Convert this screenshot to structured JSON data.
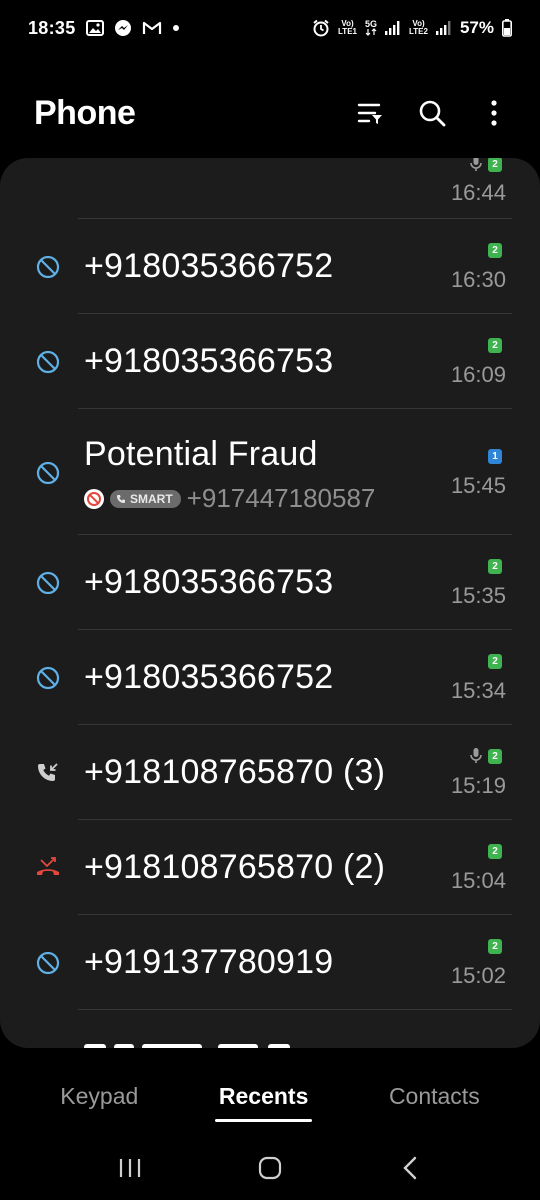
{
  "status_bar": {
    "time": "18:35",
    "battery_percent": "57%",
    "sim1_label_top": "Vo)",
    "sim1_label_bottom": "LTE1",
    "net_label": "5G",
    "sim2_label_top": "Vo)",
    "sim2_label_bottom": "LTE2",
    "notification_icons": [
      "gallery-icon",
      "messenger-icon",
      "gmail-icon",
      "dot-icon"
    ],
    "right_icons": [
      "alarm-icon",
      "signal-icon",
      "battery-icon"
    ]
  },
  "header": {
    "title": "Phone",
    "actions": [
      "filter-icon",
      "search-icon",
      "more-options-icon"
    ]
  },
  "calls": [
    {
      "name": "",
      "sub_number": "",
      "time": "16:44",
      "sim": "2",
      "type": "partial",
      "recorded": true
    },
    {
      "name": "+918035366752",
      "sub_number": "",
      "time": "16:30",
      "sim": "2",
      "type": "blocked",
      "recorded": false
    },
    {
      "name": "+918035366753",
      "sub_number": "",
      "time": "16:09",
      "sim": "2",
      "type": "blocked",
      "recorded": false
    },
    {
      "name": "Potential Fraud",
      "sub_number": "+917447180587",
      "smart_label": "SMART",
      "time": "15:45",
      "sim": "1",
      "type": "blocked",
      "recorded": false
    },
    {
      "name": "+918035366753",
      "sub_number": "",
      "time": "15:35",
      "sim": "2",
      "type": "blocked",
      "recorded": false
    },
    {
      "name": "+918035366752",
      "sub_number": "",
      "time": "15:34",
      "sim": "2",
      "type": "blocked",
      "recorded": false
    },
    {
      "name": "+918108765870 (3)",
      "sub_number": "",
      "time": "15:19",
      "sim": "2",
      "type": "incoming",
      "recorded": true
    },
    {
      "name": "+918108765870 (2)",
      "sub_number": "",
      "time": "15:04",
      "sim": "2",
      "type": "missed",
      "recorded": false
    },
    {
      "name": "+919137780919",
      "sub_number": "",
      "time": "15:02",
      "sim": "2",
      "type": "blocked",
      "recorded": false
    }
  ],
  "tabs": [
    {
      "label": "Keypad",
      "active": false
    },
    {
      "label": "Recents",
      "active": true
    },
    {
      "label": "Contacts",
      "active": false
    }
  ],
  "nav": [
    "recent-apps-icon",
    "home-icon",
    "back-icon"
  ],
  "colors": {
    "background": "#000000",
    "card": "#1c1c1c",
    "blocked_icon": "#5fb0e6",
    "missed_icon": "#e5473d",
    "sim2": "#3fb34f",
    "sim1": "#2f86d6"
  }
}
